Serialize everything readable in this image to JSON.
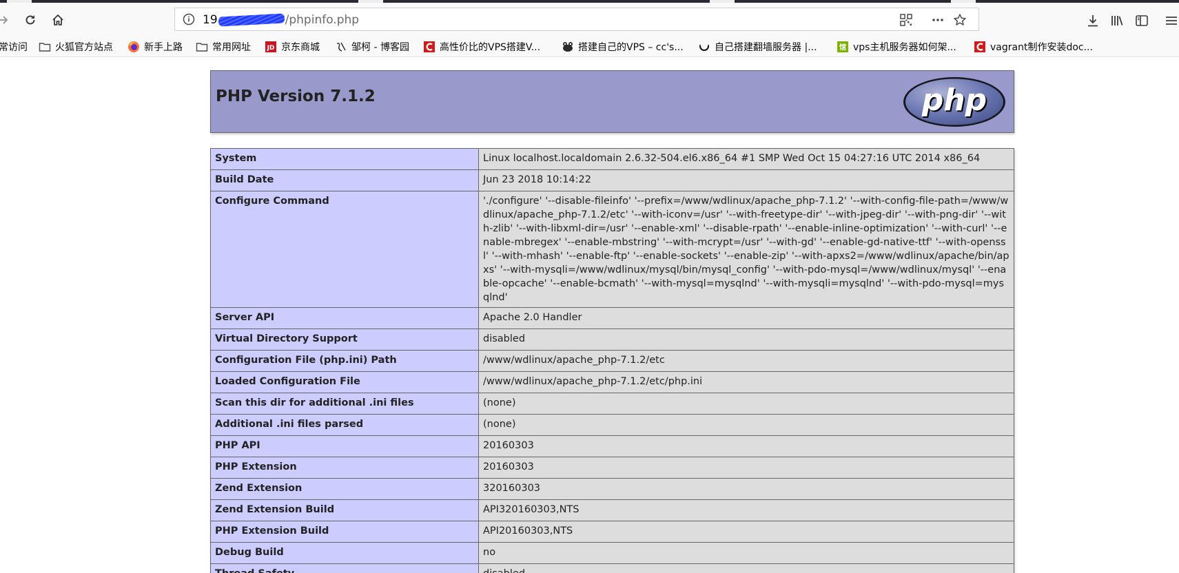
{
  "browser": {
    "url": {
      "host_visible": "19",
      "path": "/phpinfo.php"
    },
    "bookmarks": [
      {
        "label": "常访问",
        "icon": "none"
      },
      {
        "label": "火狐官方站点",
        "icon": "folder-icon"
      },
      {
        "label": "新手上路",
        "icon": "firefox-icon"
      },
      {
        "label": "常用网址",
        "icon": "folder-icon"
      },
      {
        "label": "京东商城",
        "icon": "jd-icon"
      },
      {
        "label": "邹柯 - 博客园",
        "icon": "cnblogs-icon"
      },
      {
        "label": "高性价比的VPS搭建V...",
        "icon": "c-red-icon"
      },
      {
        "label": "搭建自己的VPS – cc's...",
        "icon": "frog-icon"
      },
      {
        "label": "自己搭建翻墙服务器 |...",
        "icon": "smile-icon"
      },
      {
        "label": "vps主机服务器如何架...",
        "icon": "green-box-icon"
      },
      {
        "label": "vagrant制作安装doc...",
        "icon": "c-red-icon"
      }
    ]
  },
  "phpinfo": {
    "title": "PHP Version 7.1.2",
    "logo_text": "php",
    "rows": [
      {
        "key": "System",
        "value": "Linux localhost.localdomain 2.6.32-504.el6.x86_64 #1 SMP Wed Oct 15 04:27:16 UTC 2014 x86_64"
      },
      {
        "key": "Build Date",
        "value": "Jun 23 2018 10:14:22"
      },
      {
        "key": "Configure Command",
        "value": "'./configure' '--disable-fileinfo' '--prefix=/www/wdlinux/apache_php-7.1.2' '--with-config-file-path=/www/wdlinux/apache_php-7.1.2/etc' '--with-iconv=/usr' '--with-freetype-dir' '--with-jpeg-dir' '--with-png-dir' '--with-zlib' '--with-libxml-dir=/usr' '--enable-xml' '--disable-rpath' '--enable-inline-optimization' '--with-curl' '--enable-mbregex' '--enable-mbstring' '--with-mcrypt=/usr' '--with-gd' '--enable-gd-native-ttf' '--with-openssl' '--with-mhash' '--enable-ftp' '--enable-sockets' '--enable-zip' '--with-apxs2=/www/wdlinux/apache/bin/apxs' '--with-mysqli=/www/wdlinux/mysql/bin/mysql_config' '--with-pdo-mysql=/www/wdlinux/mysql' '--enable-opcache' '--enable-bcmath' '--with-mysql=mysqlnd' '--with-mysqli=mysqlnd' '--with-pdo-mysql=mysqlnd'"
      },
      {
        "key": "Server API",
        "value": "Apache 2.0 Handler"
      },
      {
        "key": "Virtual Directory Support",
        "value": "disabled"
      },
      {
        "key": "Configuration File (php.ini) Path",
        "value": "/www/wdlinux/apache_php-7.1.2/etc"
      },
      {
        "key": "Loaded Configuration File",
        "value": "/www/wdlinux/apache_php-7.1.2/etc/php.ini"
      },
      {
        "key": "Scan this dir for additional .ini files",
        "value": "(none)"
      },
      {
        "key": "Additional .ini files parsed",
        "value": "(none)"
      },
      {
        "key": "PHP API",
        "value": "20160303"
      },
      {
        "key": "PHP Extension",
        "value": "20160303"
      },
      {
        "key": "Zend Extension",
        "value": "320160303"
      },
      {
        "key": "Zend Extension Build",
        "value": "API320160303,NTS"
      },
      {
        "key": "PHP Extension Build",
        "value": "API20160303,NTS"
      },
      {
        "key": "Debug Build",
        "value": "no"
      },
      {
        "key": "Thread Safety",
        "value": "disabled"
      }
    ]
  },
  "colors": {
    "header_bg": "#9999cc",
    "key_cell_bg": "#ccccff",
    "value_cell_bg": "#dddddd",
    "toolbar_bg": "#f9f9fa"
  }
}
